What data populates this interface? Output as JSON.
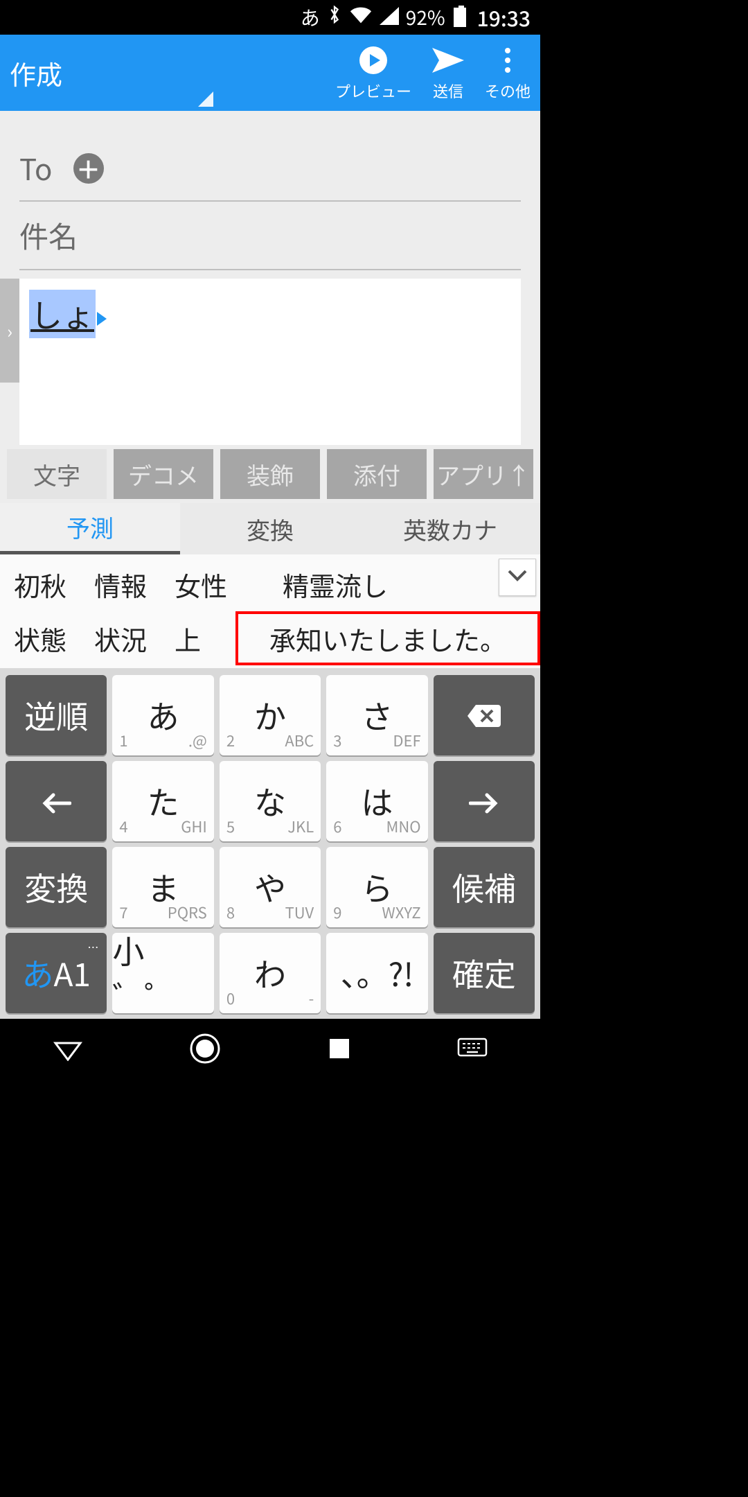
{
  "status": {
    "ime": "あ",
    "battery_pct": "92%",
    "clock": "19:33"
  },
  "appbar": {
    "title": "作成",
    "actions": {
      "preview": "プレビュー",
      "send": "送信",
      "more": "その他"
    }
  },
  "compose": {
    "to_label": "To",
    "subject_placeholder": "件名",
    "body_ime_text": "しょ"
  },
  "toolbar": {
    "tabs": [
      "文字",
      "デコメ",
      "装飾",
      "添付",
      "アプリ↑"
    ]
  },
  "ime": {
    "tabs": {
      "predict": "予測",
      "convert": "変換",
      "alnum": "英数カナ"
    },
    "candidates_row1": [
      "初秋",
      "情報",
      "女性",
      "精霊流し"
    ],
    "candidates_row2": [
      "状態",
      "状況",
      "上",
      "承知いたしました。"
    ],
    "highlight_index": 3
  },
  "keyboard": {
    "rows": [
      [
        {
          "main": "逆順",
          "dark": true
        },
        {
          "main": "あ",
          "subL": "1",
          "subR": ".@"
        },
        {
          "main": "か",
          "subL": "2",
          "subR": "ABC"
        },
        {
          "main": "さ",
          "subL": "3",
          "subR": "DEF"
        },
        {
          "icon": "backspace",
          "dark": true
        }
      ],
      [
        {
          "icon": "arrow-left",
          "dark": true
        },
        {
          "main": "た",
          "subL": "4",
          "subR": "GHI"
        },
        {
          "main": "な",
          "subL": "5",
          "subR": "JKL"
        },
        {
          "main": "は",
          "subL": "6",
          "subR": "MNO"
        },
        {
          "icon": "arrow-right",
          "dark": true
        }
      ],
      [
        {
          "main": "変換",
          "dark": true
        },
        {
          "main": "ま",
          "subL": "7",
          "subR": "PQRS"
        },
        {
          "main": "や",
          "subL": "8",
          "subR": "TUV"
        },
        {
          "main": "ら",
          "subL": "9",
          "subR": "WXYZ"
        },
        {
          "main": "候補",
          "dark": true
        }
      ],
      [
        {
          "mode": true,
          "dark": true,
          "blue": "あ",
          "rest": "A1"
        },
        {
          "main": "小 ゛゜"
        },
        {
          "main": "わ",
          "subL": "0",
          "subR": "-"
        },
        {
          "main": "、。?!"
        },
        {
          "main": "確定",
          "dark": true
        }
      ]
    ]
  }
}
